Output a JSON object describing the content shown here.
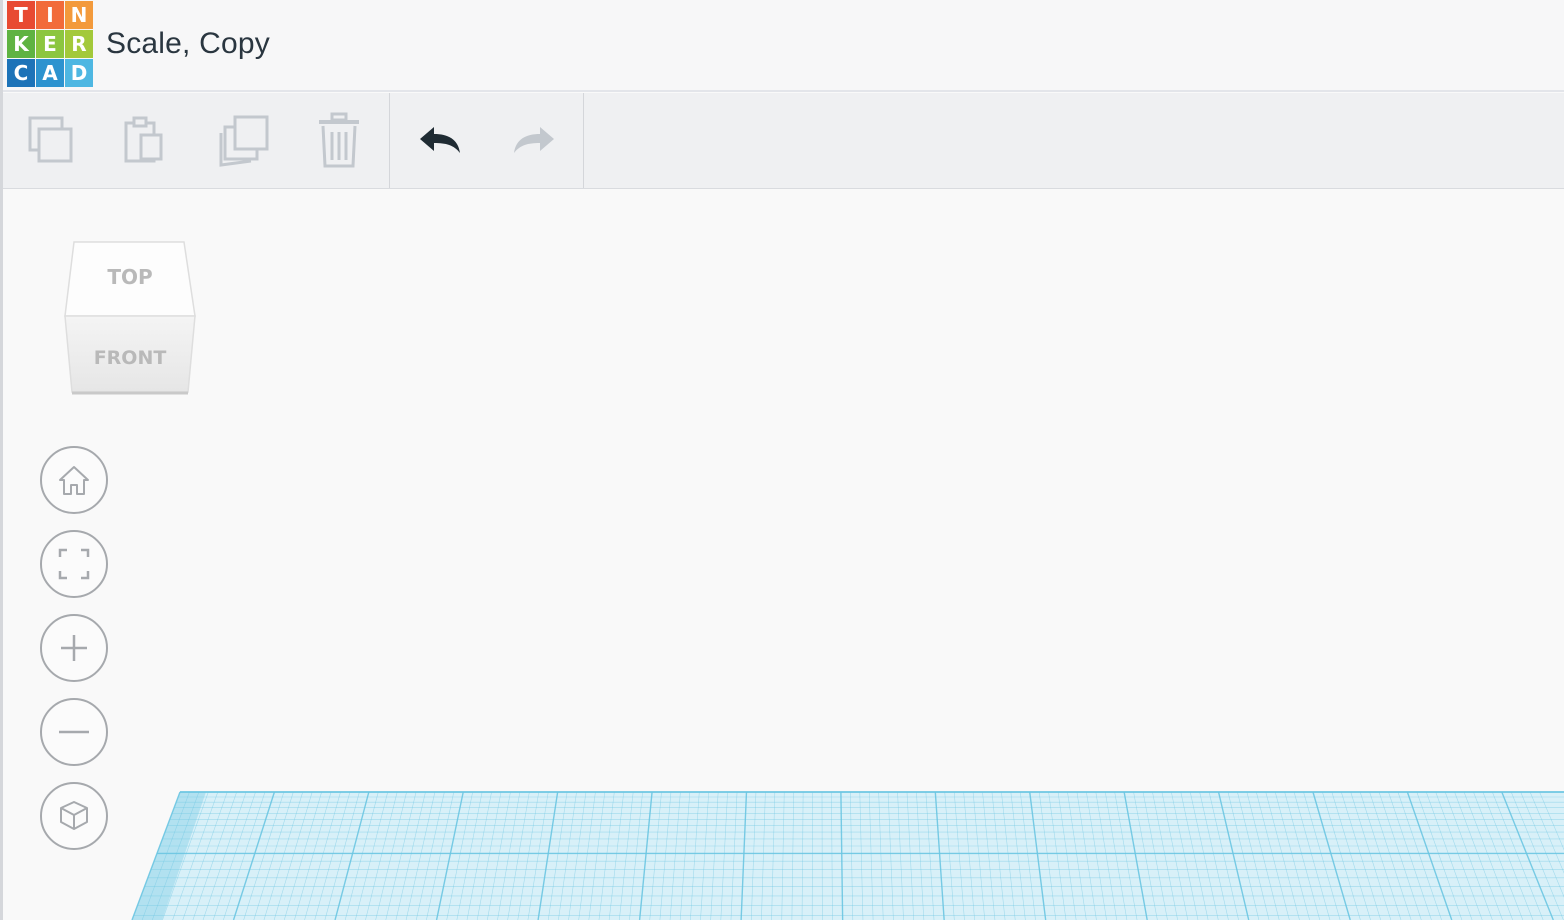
{
  "app": {
    "document_title": "Scale, Copy",
    "logo": {
      "letters": [
        "T",
        "I",
        "N",
        "K",
        "E",
        "R",
        "C",
        "A",
        "D"
      ],
      "colors": [
        "#e84a32",
        "#f26b3a",
        "#f39a3c",
        "#5fb342",
        "#8cc63f",
        "#a3c93a",
        "#1d73b8",
        "#2d93cf",
        "#4eb7e2"
      ]
    }
  },
  "toolbar": {
    "edit_tools": [
      {
        "name": "copy",
        "icon": "copy-icon",
        "enabled": false
      },
      {
        "name": "paste",
        "icon": "paste-icon",
        "enabled": false
      },
      {
        "name": "duplicate",
        "icon": "duplicate-icon",
        "enabled": false
      },
      {
        "name": "delete",
        "icon": "trash-icon",
        "enabled": false
      }
    ],
    "history_tools": [
      {
        "name": "undo",
        "icon": "undo-icon",
        "enabled": true
      },
      {
        "name": "redo",
        "icon": "redo-icon",
        "enabled": false
      }
    ]
  },
  "view_cube": {
    "top_label": "TOP",
    "front_label": "FRONT"
  },
  "nav_controls": [
    {
      "name": "home-view",
      "icon": "home-icon"
    },
    {
      "name": "fit-all",
      "icon": "fit-view-icon"
    },
    {
      "name": "zoom-in",
      "icon": "plus-icon"
    },
    {
      "name": "zoom-out",
      "icon": "minus-icon"
    },
    {
      "name": "projection",
      "icon": "cube-icon"
    }
  ],
  "colors": {
    "grid_line": "#6cc6e2",
    "grid_fill": "#d8f0f8",
    "icon_disabled": "#c3c8ce",
    "icon_active": "#1f2b33"
  }
}
